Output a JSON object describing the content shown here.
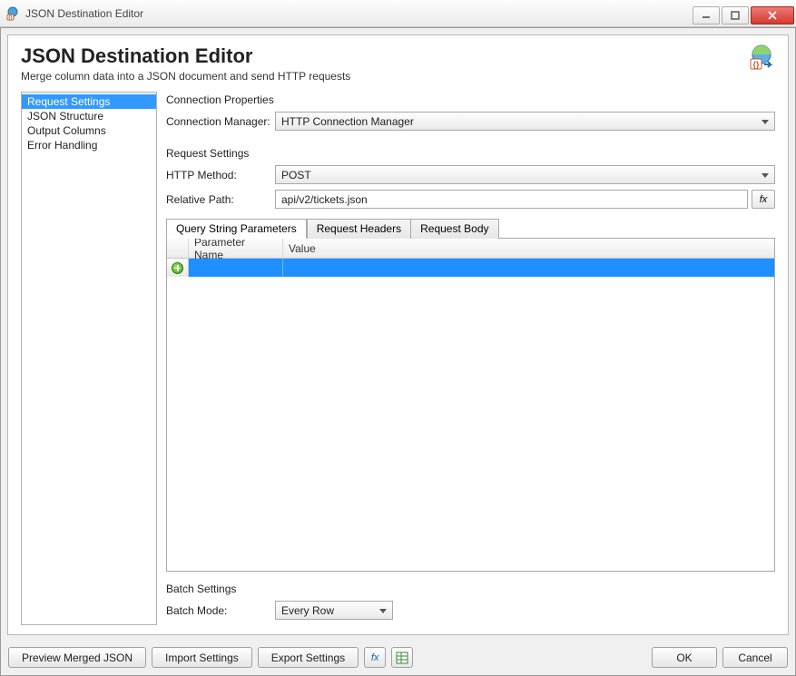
{
  "window": {
    "title": "JSON Destination Editor"
  },
  "header": {
    "title": "JSON Destination Editor",
    "subtitle": "Merge column data into a JSON document and send HTTP requests"
  },
  "sidebar": {
    "items": [
      {
        "label": "Request Settings",
        "selected": true
      },
      {
        "label": "JSON Structure",
        "selected": false
      },
      {
        "label": "Output Columns",
        "selected": false
      },
      {
        "label": "Error Handling",
        "selected": false
      }
    ]
  },
  "connection": {
    "section_label": "Connection Properties",
    "manager_label": "Connection Manager:",
    "manager_value": "HTTP Connection Manager"
  },
  "request": {
    "section_label": "Request Settings",
    "method_label": "HTTP Method:",
    "method_value": "POST",
    "path_label": "Relative Path:",
    "path_value": "api/v2/tickets.json",
    "fx_label": "fx"
  },
  "tabs": {
    "items": [
      {
        "label": "Query String Parameters",
        "active": true
      },
      {
        "label": "Request Headers",
        "active": false
      },
      {
        "label": "Request Body",
        "active": false
      }
    ]
  },
  "grid": {
    "columns": {
      "name": "Parameter Name",
      "value": "Value"
    },
    "rows": [
      {
        "name": "",
        "value": ""
      }
    ]
  },
  "batch": {
    "section_label": "Batch Settings",
    "mode_label": "Batch Mode:",
    "mode_value": "Every Row"
  },
  "footer": {
    "preview": "Preview Merged JSON",
    "import": "Import Settings",
    "export": "Export Settings",
    "ok": "OK",
    "cancel": "Cancel"
  }
}
